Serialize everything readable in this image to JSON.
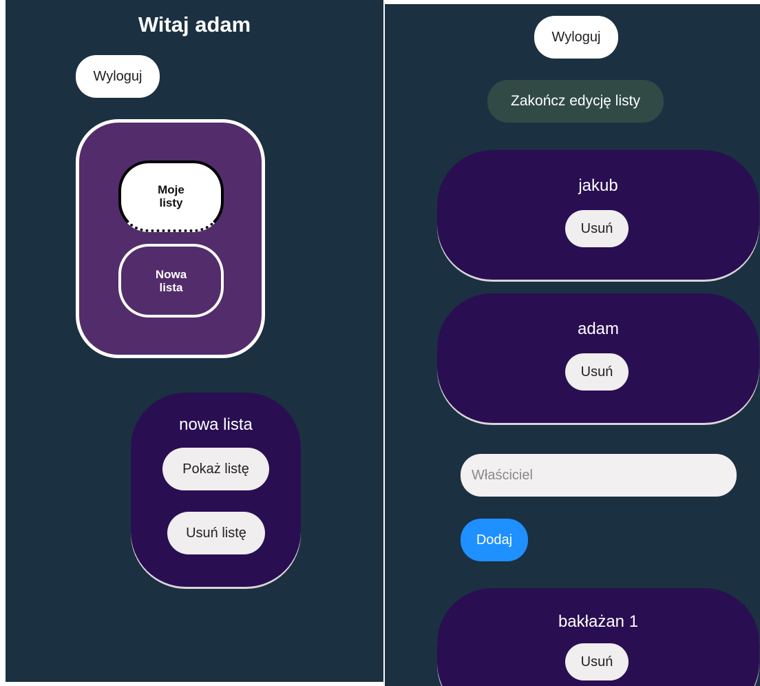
{
  "left_panel": {
    "greeting": "Witaj adam",
    "logout_label": "Wyloguj",
    "menu": {
      "my_lists_line1": "Moje",
      "my_lists_line2": "listy",
      "new_list_line1": "Nowa",
      "new_list_line2": "lista"
    },
    "list_card": {
      "name": "nowa lista",
      "show_label": "Pokaż listę",
      "delete_label": "Usuń listę"
    }
  },
  "right_panel": {
    "logout_label": "Wyloguj",
    "end_edit_label": "Zakończ edycję listy",
    "owners": [
      {
        "name": "jakub",
        "remove_label": "Usuń"
      },
      {
        "name": "adam",
        "remove_label": "Usuń"
      }
    ],
    "owner_input": {
      "placeholder": "Właściciel",
      "value": ""
    },
    "add_label": "Dodaj",
    "items": [
      {
        "name": "bakłażan 1",
        "remove_label": "Usuń"
      }
    ]
  },
  "colors": {
    "background": "#1b3041",
    "menu_purple": "#532c6b",
    "card_purple": "#2a0e52",
    "end_edit_green": "#314a46",
    "add_blue": "#1e90ff"
  },
  "icons": []
}
